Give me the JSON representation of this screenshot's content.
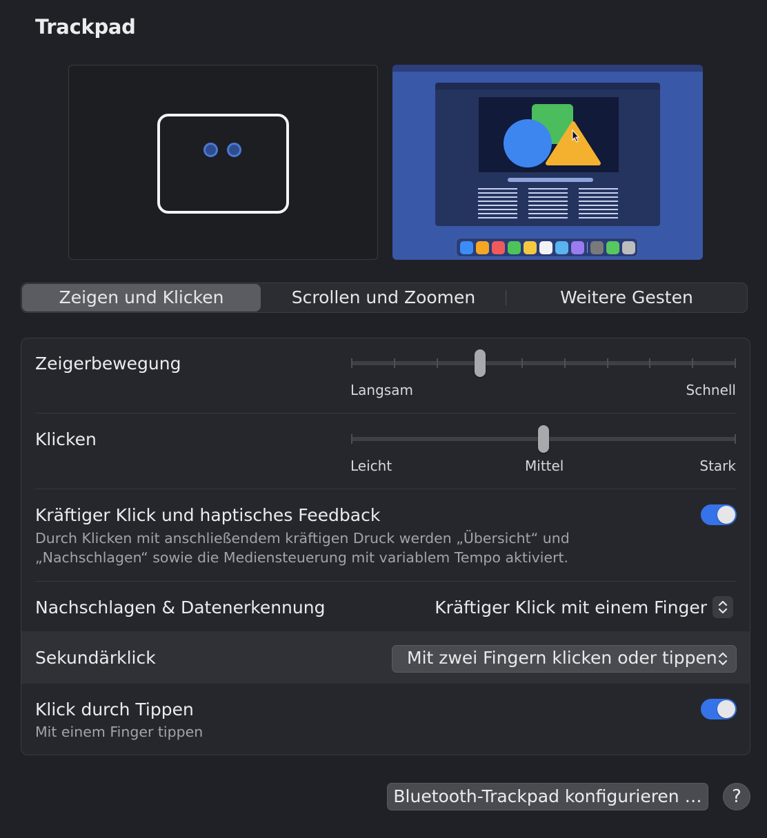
{
  "window": {
    "title": "Trackpad"
  },
  "tabs": [
    {
      "label": "Zeigen und Klicken",
      "active": true
    },
    {
      "label": "Scrollen und Zoomen",
      "active": false
    },
    {
      "label": "Weitere Gesten",
      "active": false
    }
  ],
  "settings": {
    "pointer_speed": {
      "label": "Zeigerbewegung",
      "min_label": "Langsam",
      "max_label": "Schnell",
      "ticks": 10,
      "value_step": 3
    },
    "click": {
      "label": "Klicken",
      "min_label": "Leicht",
      "mid_label": "Mittel",
      "max_label": "Stark",
      "value": "Mittel"
    },
    "force_click": {
      "label": "Kräftiger Klick und haptisches Feedback",
      "description_line1": "Durch Klicken mit anschließendem kräftigen Druck werden „Übersicht“ und",
      "description_line2": "„Nachschlagen“ sowie die Mediensteuerung mit variablem Tempo aktiviert.",
      "enabled": true
    },
    "lookup": {
      "label": "Nachschlagen & Datenerkennung",
      "value": "Kräftiger Klick mit einem Finger"
    },
    "secondary_click": {
      "label": "Sekundärklick",
      "value": "Mit zwei Fingern klicken oder tippen"
    },
    "tap_to_click": {
      "label": "Klick durch Tippen",
      "description": "Mit einem Finger tippen",
      "enabled": true
    }
  },
  "footer": {
    "bluetooth_button": "Bluetooth-Trackpad konfigurieren …",
    "help_button": "?"
  },
  "colors": {
    "accent": "#3673e8",
    "preview_bg": "#3a58a8"
  },
  "dock_app_colors": [
    "#3b8cf5",
    "#f5a623",
    "#f05a5a",
    "#4cc45a",
    "#f5c842",
    "#f2f2f2",
    "#5ab4f0",
    "#9b7cf0",
    "#7a7a7a",
    "#56c85f",
    "#bdbdbd"
  ]
}
